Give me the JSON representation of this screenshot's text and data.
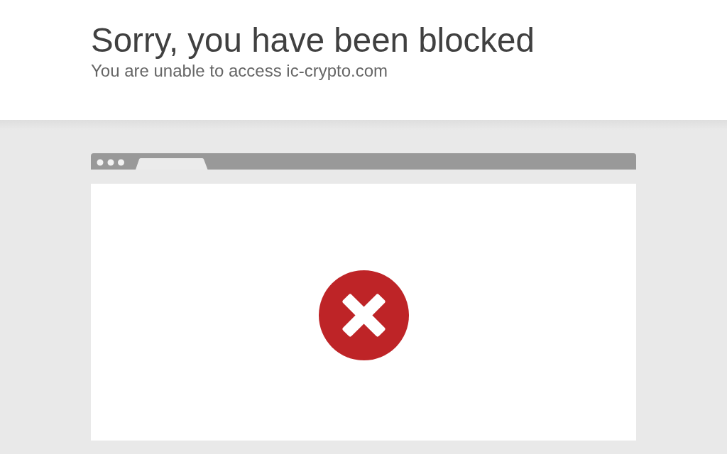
{
  "header": {
    "title": "Sorry, you have been blocked",
    "subtitle": "You are unable to access ic-crypto.com"
  }
}
